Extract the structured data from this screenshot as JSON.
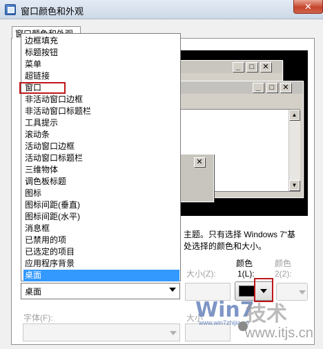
{
  "window": {
    "title": "窗口颜色和外观",
    "close_glyph": "✕"
  },
  "tab": {
    "label": "窗口颜色和外观"
  },
  "preview": {
    "btn_min": "_",
    "btn_max": "□",
    "btn_close": "✕",
    "scroll_up": "▲",
    "scroll_down": "▼"
  },
  "description": {
    "line1": "主题。只有选择 Windows 7“基",
    "line2": "处选择的颜色和大小。"
  },
  "item_list": {
    "items": [
      "边框填充",
      "标题按钮",
      "菜单",
      "超链接",
      "窗口",
      "非活动窗口边框",
      "非活动窗口标题栏",
      "工具提示",
      "滚动条",
      "活动窗口边框",
      "活动窗口标题栏",
      "三维物体",
      "调色板标题",
      "图标",
      "图标间距(垂直)",
      "图标间距(水平)",
      "消息框",
      "已禁用的项",
      "已选定的项目",
      "应用程序背景",
      "桌面"
    ],
    "selected_index": 20,
    "highlighted_index": 4
  },
  "item_combo": {
    "value": "桌面"
  },
  "size": {
    "label": "大小(Z):"
  },
  "color1": {
    "label_top": "颜色",
    "label_bottom": "1(L):",
    "value_color": "#000000"
  },
  "color2": {
    "label_top": "颜色",
    "label_bottom": "2(2):"
  },
  "font": {
    "label": "字体(F):"
  },
  "font_size": {
    "label": "大小"
  },
  "watermark": {
    "site1": "Win7",
    "site1_url": "www.win7zhijia.cn",
    "site2": "技术",
    "site2_url": "www.itjs.cn"
  },
  "colors": {
    "selection": "#3399ff",
    "annotation_red": "#c0161a"
  }
}
